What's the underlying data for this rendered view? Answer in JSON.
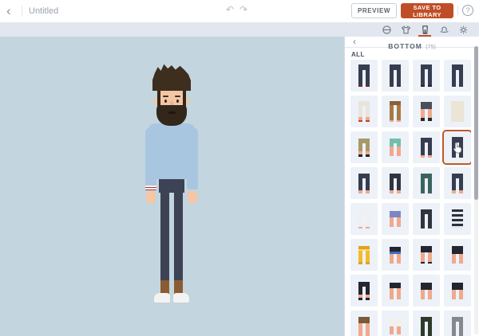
{
  "topbar": {
    "title": "Untitled",
    "preview_label": "PREVIEW",
    "save_label": "SAVE TO LIBRARY",
    "undo_glyph": "↶",
    "redo_glyph": "↷",
    "back_glyph": "‹",
    "help_glyph": "?",
    "accent_color": "#bf4e26"
  },
  "toolbar": {
    "tabs": [
      {
        "name": "head",
        "selected": false
      },
      {
        "name": "top",
        "selected": false
      },
      {
        "name": "bottom",
        "selected": true
      },
      {
        "name": "hat",
        "selected": false
      },
      {
        "name": "settings",
        "selected": false
      }
    ]
  },
  "canvas": {
    "bg": "#c3d5de"
  },
  "character": {
    "colors": {
      "skin": "#f3c6a5",
      "hair": "#3e2e1e",
      "beard": "#33261a",
      "eyes": "#2b2b2b",
      "nose": "#e8b491",
      "mouth": "#20160d",
      "sweater": "#a9c6e1",
      "pants": "#3d4254",
      "boots": "#8a5c33",
      "shoes": "#f3f3f3",
      "wrist_base": "#f3f4f5",
      "wrist_stripe": "#b5342c"
    }
  },
  "sidebar": {
    "panel_title": "BOTTOM",
    "panel_count": "(75)",
    "back_glyph": "‹",
    "filter_label": "ALL",
    "skin_color": "#f0a98c",
    "selected_border": "#c05a2a",
    "selected_index": 11,
    "items": [
      {
        "waist": "#363d50",
        "waistH": 7,
        "leg": "#363d50",
        "legH": 19,
        "shoe": "#6e2b2b",
        "shoeH": 2
      },
      {
        "waist": "#363d50",
        "waistH": 7,
        "leg": "#363d50",
        "legH": 21
      },
      {
        "waist": "#363d50",
        "waistH": 6,
        "leg": "#363d50",
        "legH": 20,
        "shoe": "#23262e",
        "shoeH": 2
      },
      {
        "waist": "#363d50",
        "waistH": 7,
        "leg": "#363d50",
        "legH": 21
      },
      {
        "waist": "#e9e4db",
        "waistH": 6,
        "leg": "#e9e4db",
        "legH": 14,
        "skinH": 4,
        "shoe": "#b8452f",
        "shoeH": 2
      },
      {
        "waist": "#8a6134",
        "waistH": 5,
        "leg": "#a57a45",
        "legH": 19,
        "skinH": 2
      },
      {
        "waist": "#4a4f5a",
        "waistH": 9,
        "skinH": 11,
        "shoe": "#23262e",
        "shoeH": 4
      },
      {
        "style": "skirt",
        "waist": "#eae5d4",
        "waistH": 26
      },
      {
        "waist": "#a89a68",
        "waistH": 6,
        "leg": "#a89a68",
        "legH": 10,
        "skinH": 4,
        "shoe": "#23262e",
        "shoeH": 3
      },
      {
        "waist": "#72bfab",
        "waistH": 6,
        "leg": "#72bfab",
        "legH": 4,
        "skinH": 12
      },
      {
        "waist": "#363d50",
        "waistH": 6,
        "leg": "#363d50",
        "legH": 16,
        "skinH": 3
      },
      {
        "waist": "#363d50",
        "waistH": 7,
        "leg": "#363d50",
        "legH": 19
      },
      {
        "waist": "#363d50",
        "waistH": 6,
        "leg": "#363d50",
        "legH": 15,
        "skinH": 4
      },
      {
        "waist": "#2e3440",
        "waistH": 6,
        "leg": "#2e3440",
        "legH": 15,
        "skinH": 4
      },
      {
        "waist": "#3a655f",
        "waistH": 6,
        "leg": "#3a655f",
        "legH": 19
      },
      {
        "waist": "#363d50",
        "waistH": 6,
        "leg": "#363d50",
        "legH": 15,
        "skinH": 4
      },
      {
        "waist": "#eff0f2",
        "waistH": 6,
        "leg": "#eff0f2",
        "legH": 15,
        "skinH": 2
      },
      {
        "waist": "#7b86c2",
        "waistH": 8,
        "skinH": 12
      },
      {
        "waist": "#30343f",
        "waistH": 6,
        "leg": "#30343f",
        "legH": 18
      },
      {
        "style": "stripes",
        "waist": "#2c303a",
        "gap": "#e6e9f2",
        "waistH": 24
      },
      {
        "waist": "#e3a11c",
        "waistH": 4,
        "band": "#f7d978",
        "bandH": 2,
        "leg": "#f3ba30",
        "legH": 14,
        "shoe": "#e3a11c",
        "shoeH": 3
      },
      {
        "waist": "#23262e",
        "waistH": 6,
        "band": "#3f6dc0",
        "bandH": 3,
        "skinH": 12
      },
      {
        "waist": "#23262e",
        "waistH": 8,
        "skinH": 12,
        "shoe": "#23262e",
        "shoeH": 2
      },
      {
        "waist": "#23262e",
        "waistH": 10,
        "skinH": 12
      },
      {
        "waist": "#23262e",
        "waistH": 6,
        "leg": "#23262e",
        "legH": 10,
        "skinH": 4,
        "shoe": "#23262e",
        "shoeH": 3
      },
      {
        "waist": "#23262e",
        "waistH": 7,
        "skinH": 14
      },
      {
        "waist": "#23262e",
        "waistH": 9,
        "skinH": 12
      },
      {
        "waist": "#23262e",
        "waistH": 9,
        "skinH": 12
      },
      {
        "waist": "#7a5a38",
        "waistH": 8,
        "skinH": 16
      },
      {
        "waist": "#f2f0ec",
        "waistH": 10,
        "skinH": 10
      },
      {
        "waist": "#2e3b2c",
        "waistH": 6,
        "leg": "#2e3b2c",
        "legH": 19
      },
      {
        "waist": "#85898f",
        "waistH": 6,
        "leg": "#85898f",
        "legH": 19
      }
    ]
  }
}
